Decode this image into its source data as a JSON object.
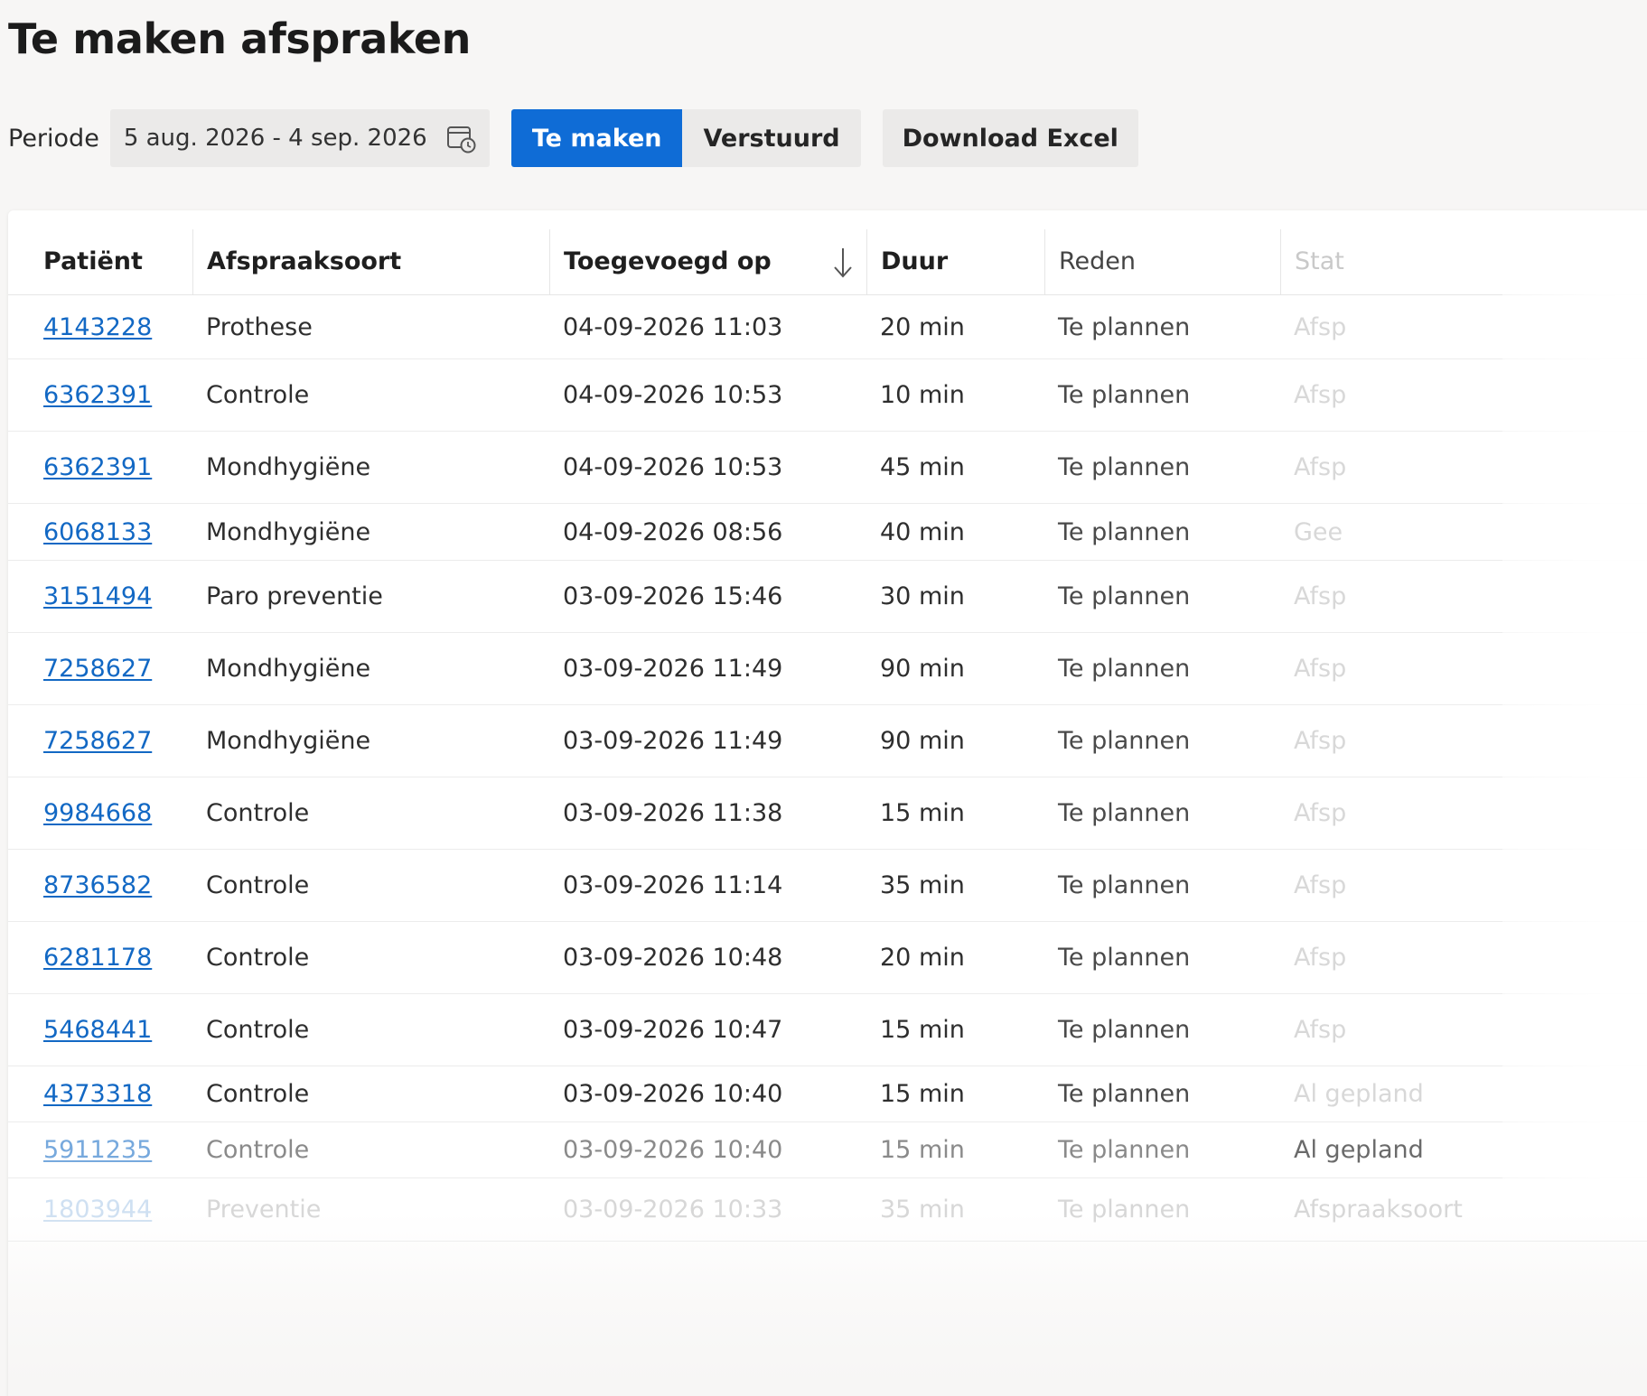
{
  "page": {
    "title": "Te maken afspraken"
  },
  "toolbar": {
    "period_label": "Periode",
    "date_range": "5 aug. 2026 - 4 sep. 2026",
    "tab_to_make": "Te maken",
    "tab_sent": "Verstuurd",
    "download_label": "Download Excel"
  },
  "table": {
    "headers": {
      "patient": "Patiënt",
      "type": "Afspraaksoort",
      "added": "Toegevoegd op",
      "duration": "Duur",
      "reason": "Reden",
      "status": "Stat"
    },
    "rows": [
      {
        "patient": "4143228",
        "type": "Prothese",
        "added": "04-09-2026 11:03",
        "duration": "20 min",
        "reason": "Te plannen",
        "status": "Afsp"
      },
      {
        "patient": "6362391",
        "type": "Controle",
        "added": "04-09-2026 10:53",
        "duration": "10 min",
        "reason": "Te plannen",
        "status": "Afsp"
      },
      {
        "patient": "6362391",
        "type": "Mondhygiëne",
        "added": "04-09-2026 10:53",
        "duration": "45 min",
        "reason": "Te plannen",
        "status": "Afsp"
      },
      {
        "patient": "6068133",
        "type": "Mondhygiëne",
        "added": "04-09-2026 08:56",
        "duration": "40 min",
        "reason": "Te plannen",
        "status": "Gee"
      },
      {
        "patient": "3151494",
        "type": "Paro preventie",
        "added": "03-09-2026 15:46",
        "duration": "30 min",
        "reason": "Te plannen",
        "status": "Afsp"
      },
      {
        "patient": "7258627",
        "type": "Mondhygiëne",
        "added": "03-09-2026 11:49",
        "duration": "90 min",
        "reason": "Te plannen",
        "status": "Afsp"
      },
      {
        "patient": "7258627",
        "type": "Mondhygiëne",
        "added": "03-09-2026 11:49",
        "duration": "90 min",
        "reason": "Te plannen",
        "status": "Afsp"
      },
      {
        "patient": "9984668",
        "type": "Controle",
        "added": "03-09-2026 11:38",
        "duration": "15 min",
        "reason": "Te plannen",
        "status": "Afsp"
      },
      {
        "patient": "8736582",
        "type": "Controle",
        "added": "03-09-2026 11:14",
        "duration": "35 min",
        "reason": "Te plannen",
        "status": "Afsp"
      },
      {
        "patient": "6281178",
        "type": "Controle",
        "added": "03-09-2026 10:48",
        "duration": "20 min",
        "reason": "Te plannen",
        "status": "Afsp"
      },
      {
        "patient": "5468441",
        "type": "Controle",
        "added": "03-09-2026 10:47",
        "duration": "15 min",
        "reason": "Te plannen",
        "status": "Afsp"
      },
      {
        "patient": "4373318",
        "type": "Controle",
        "added": "03-09-2026 10:40",
        "duration": "15 min",
        "reason": "Te plannen",
        "status": "Al gepland"
      },
      {
        "patient": "5911235",
        "type": "Controle",
        "added": "03-09-2026 10:40",
        "duration": "15 min",
        "reason": "Te plannen",
        "status": "Al gepland"
      },
      {
        "patient": "1803944",
        "type": "Preventie",
        "added": "03-09-2026 10:33",
        "duration": "35 min",
        "reason": "Te plannen",
        "status": "Afspraaksoort"
      }
    ]
  },
  "icons": {
    "calendar": "calendar-clock-icon",
    "sort": "arrow-down-icon"
  },
  "colors": {
    "accent": "#0f6cd6",
    "link": "#1268c4"
  }
}
